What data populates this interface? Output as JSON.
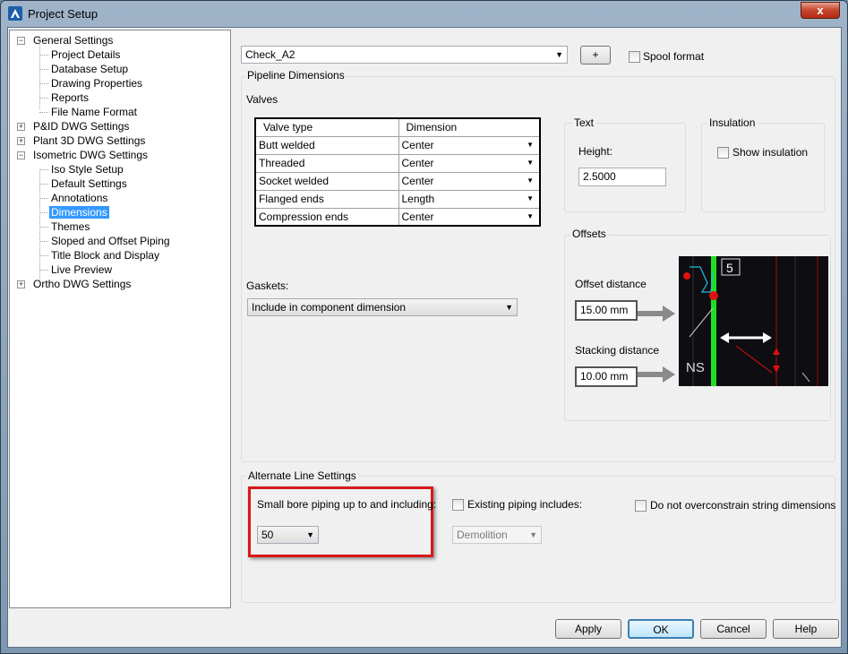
{
  "window": {
    "title": "Project Setup",
    "close_glyph": "x"
  },
  "tree": {
    "items": [
      {
        "label": "General Settings",
        "expander": "−"
      },
      {
        "label": "Project Details"
      },
      {
        "label": "Database Setup"
      },
      {
        "label": "Drawing Properties"
      },
      {
        "label": "Reports"
      },
      {
        "label": "File Name Format"
      },
      {
        "label": "P&ID DWG Settings",
        "expander": "+"
      },
      {
        "label": "Plant 3D DWG Settings",
        "expander": "+"
      },
      {
        "label": "Isometric DWG Settings",
        "expander": "−"
      },
      {
        "label": "Iso Style Setup"
      },
      {
        "label": "Default Settings"
      },
      {
        "label": "Annotations"
      },
      {
        "label": "Dimensions",
        "selected": true
      },
      {
        "label": "Themes"
      },
      {
        "label": "Sloped and Offset Piping"
      },
      {
        "label": "Title Block and Display"
      },
      {
        "label": "Live Preview"
      },
      {
        "label": "Ortho DWG Settings",
        "expander": "+"
      }
    ]
  },
  "style_combo": {
    "value": "Check_A2"
  },
  "plus_button": {
    "label": "+"
  },
  "spool_format": {
    "label": "Spool format",
    "checked": false
  },
  "pipeline_dimensions": {
    "title": "Pipeline Dimensions",
    "valves_label": "Valves",
    "table": {
      "headers": [
        "Valve type",
        "Dimension"
      ],
      "rows": [
        [
          "Butt welded",
          "Center"
        ],
        [
          "Threaded",
          "Center"
        ],
        [
          "Socket welded",
          "Center"
        ],
        [
          "Flanged ends",
          "Length"
        ],
        [
          "Compression ends",
          "Center"
        ]
      ]
    },
    "gaskets_label": "Gaskets:",
    "gaskets_value": "Include in component dimension"
  },
  "text_group": {
    "title": "Text",
    "height_label": "Height:",
    "height_value": "2.5000"
  },
  "insulation_group": {
    "title": "Insulation",
    "show_label": "Show insulation",
    "checked": false
  },
  "offsets_group": {
    "title": "Offsets",
    "offset_label": "Offset distance",
    "offset_value": "15.00 mm",
    "stacking_label": "Stacking distance",
    "stacking_value": "10.00 mm",
    "preview": {
      "badge": "5",
      "ns": "NS"
    }
  },
  "alternate": {
    "title": "Alternate Line Settings",
    "small_bore_label": "Small bore piping up to and including:",
    "small_bore_value": "50",
    "existing_label": "Existing piping includes:",
    "existing_checked": false,
    "existing_value": "Demolition",
    "overconstrain_label": "Do not overconstrain string dimensions",
    "overconstrain_checked": false
  },
  "buttons": {
    "apply": "Apply",
    "ok": "OK",
    "cancel": "Cancel",
    "help": "Help"
  },
  "colors": {
    "highlight_red": "#e01010",
    "selection_blue": "#3399ff",
    "pipe_green": "#22dd22"
  }
}
